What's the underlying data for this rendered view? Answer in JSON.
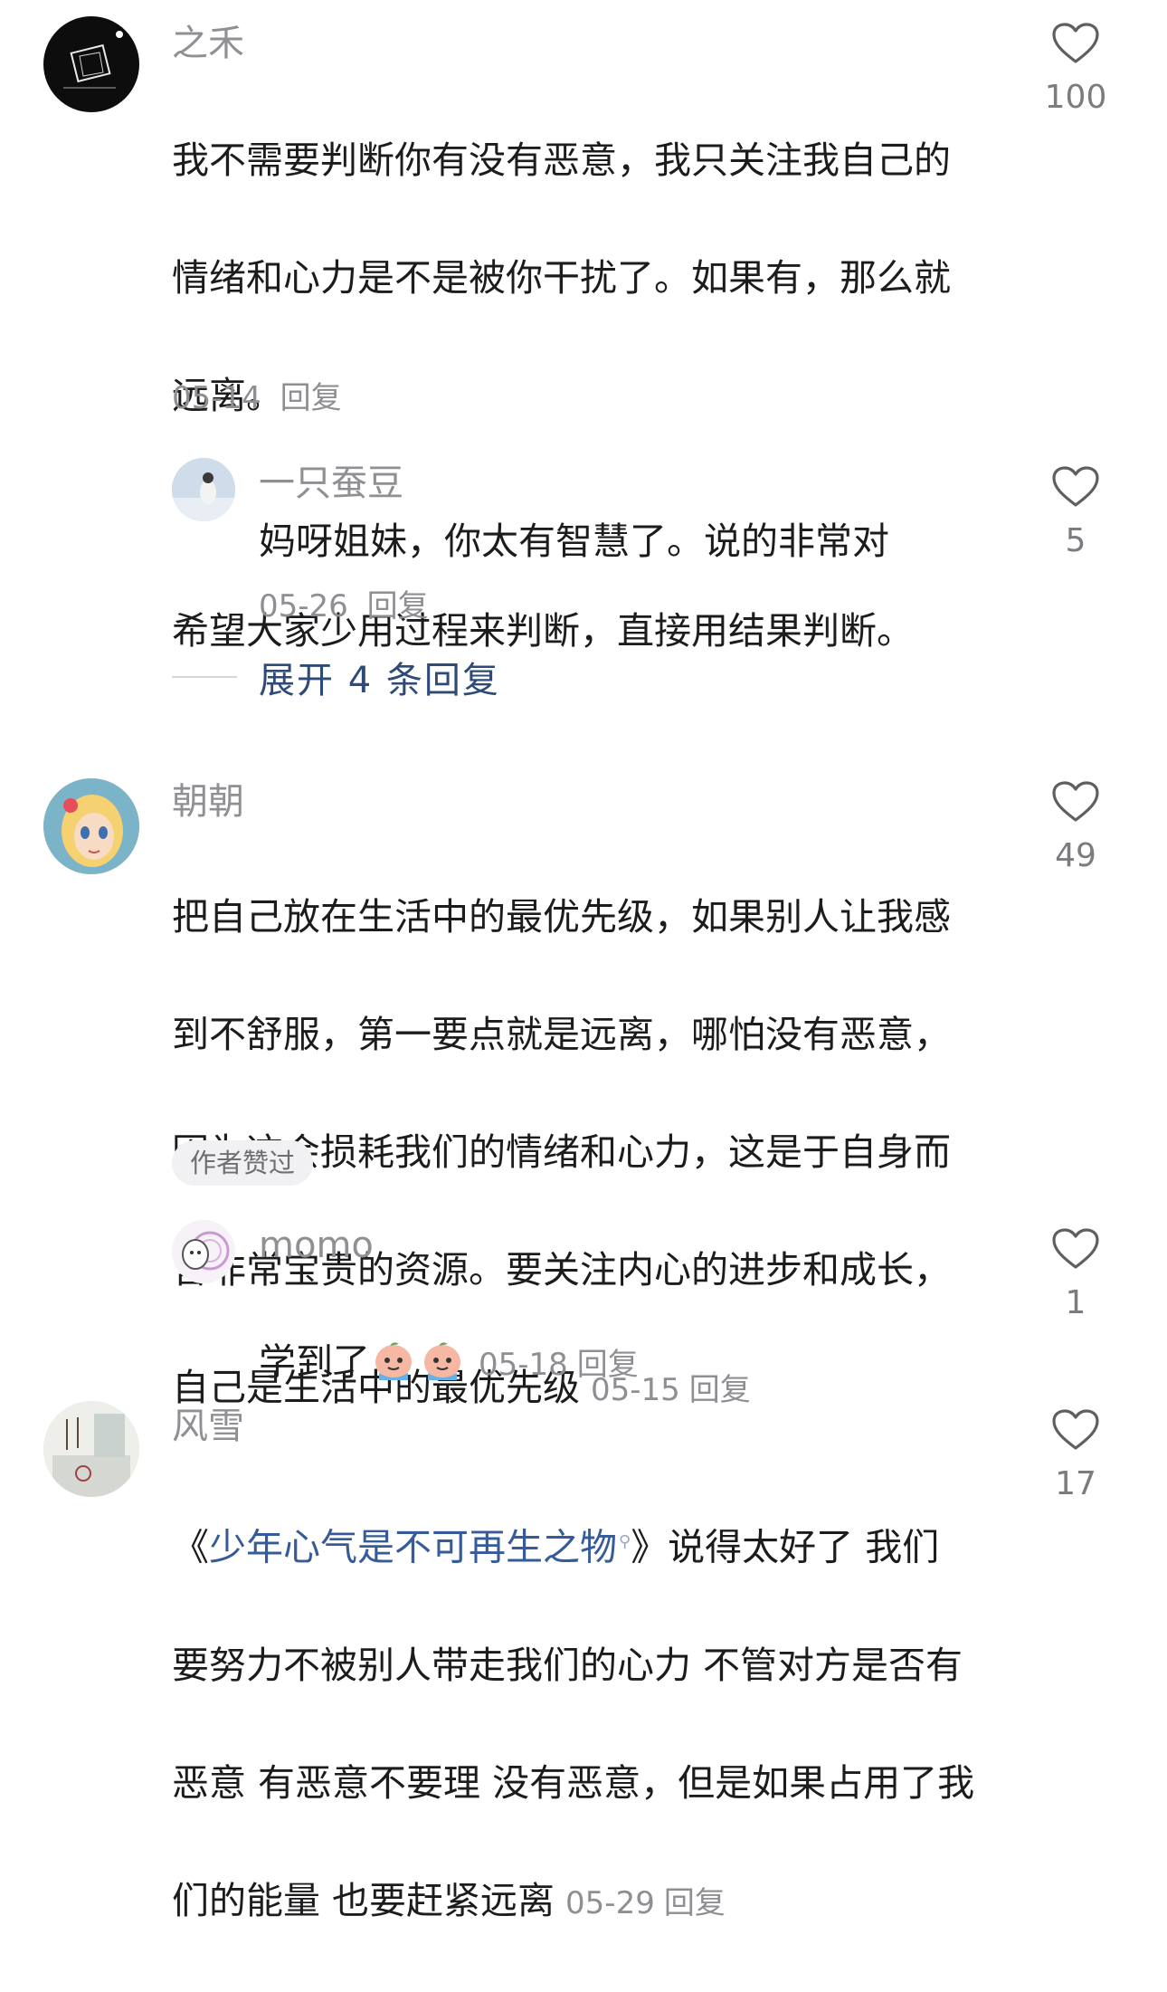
{
  "comments": [
    {
      "author": "之禾",
      "text_line1": "我不需要判断你有没有恶意，我只关注我自己的",
      "text_line2": "情绪和心力是不是被你干扰了。如果有，那么就",
      "text_line3": "远离。",
      "text_line4": "希望大家少用过程来判断，直接用结果判断。",
      "date": "05-14",
      "reply_label": "回复",
      "likes": "100"
    },
    {
      "author": "一只蚕豆",
      "text": "妈呀姐妹，你太有智慧了。说的非常对",
      "date": "05-26",
      "reply_label": "回复",
      "likes": "5"
    },
    {
      "author": "朝朝",
      "text_line1": "把自己放在生活中的最优先级，如果别人让我感",
      "text_line2": "到不舒服，第一要点就是远离，哪怕没有恶意，",
      "text_line3": "因为这会损耗我们的情绪和心力，这是于自身而",
      "text_line4": "言非常宝贵的资源。要关注内心的进步和成长，",
      "text_line5": "自己是生活中的最优先级",
      "date": "05-15",
      "reply_label": "回复",
      "badge": "作者赞过",
      "likes": "49"
    },
    {
      "author": "momo",
      "text": "学到了",
      "date": "05-18",
      "reply_label": "回复",
      "likes": "1"
    },
    {
      "author": "风雪",
      "quote_open": "《",
      "link_text": "少年心气是不可再生之物",
      "quote_close": "》说得太好了  我们",
      "text_line2": "要努力不被别人带走我们的心力  不管对方是否有",
      "text_line3": "恶意  有恶意不要理 没有恶意，但是如果占用了我",
      "text_line4": "们的能量   也要赶紧远离",
      "date": "05-29",
      "reply_label": "回复",
      "likes": "17"
    }
  ],
  "expand_replies": "展开 4 条回复",
  "icons": {
    "like": "heart-outline-icon",
    "search": "search-mini-icon",
    "emoji": "crying-peach-emoji"
  },
  "colors": {
    "author": "#8f8f94",
    "meta": "#8e8e93",
    "link": "#365b9b",
    "expand": "#2e4a76"
  }
}
